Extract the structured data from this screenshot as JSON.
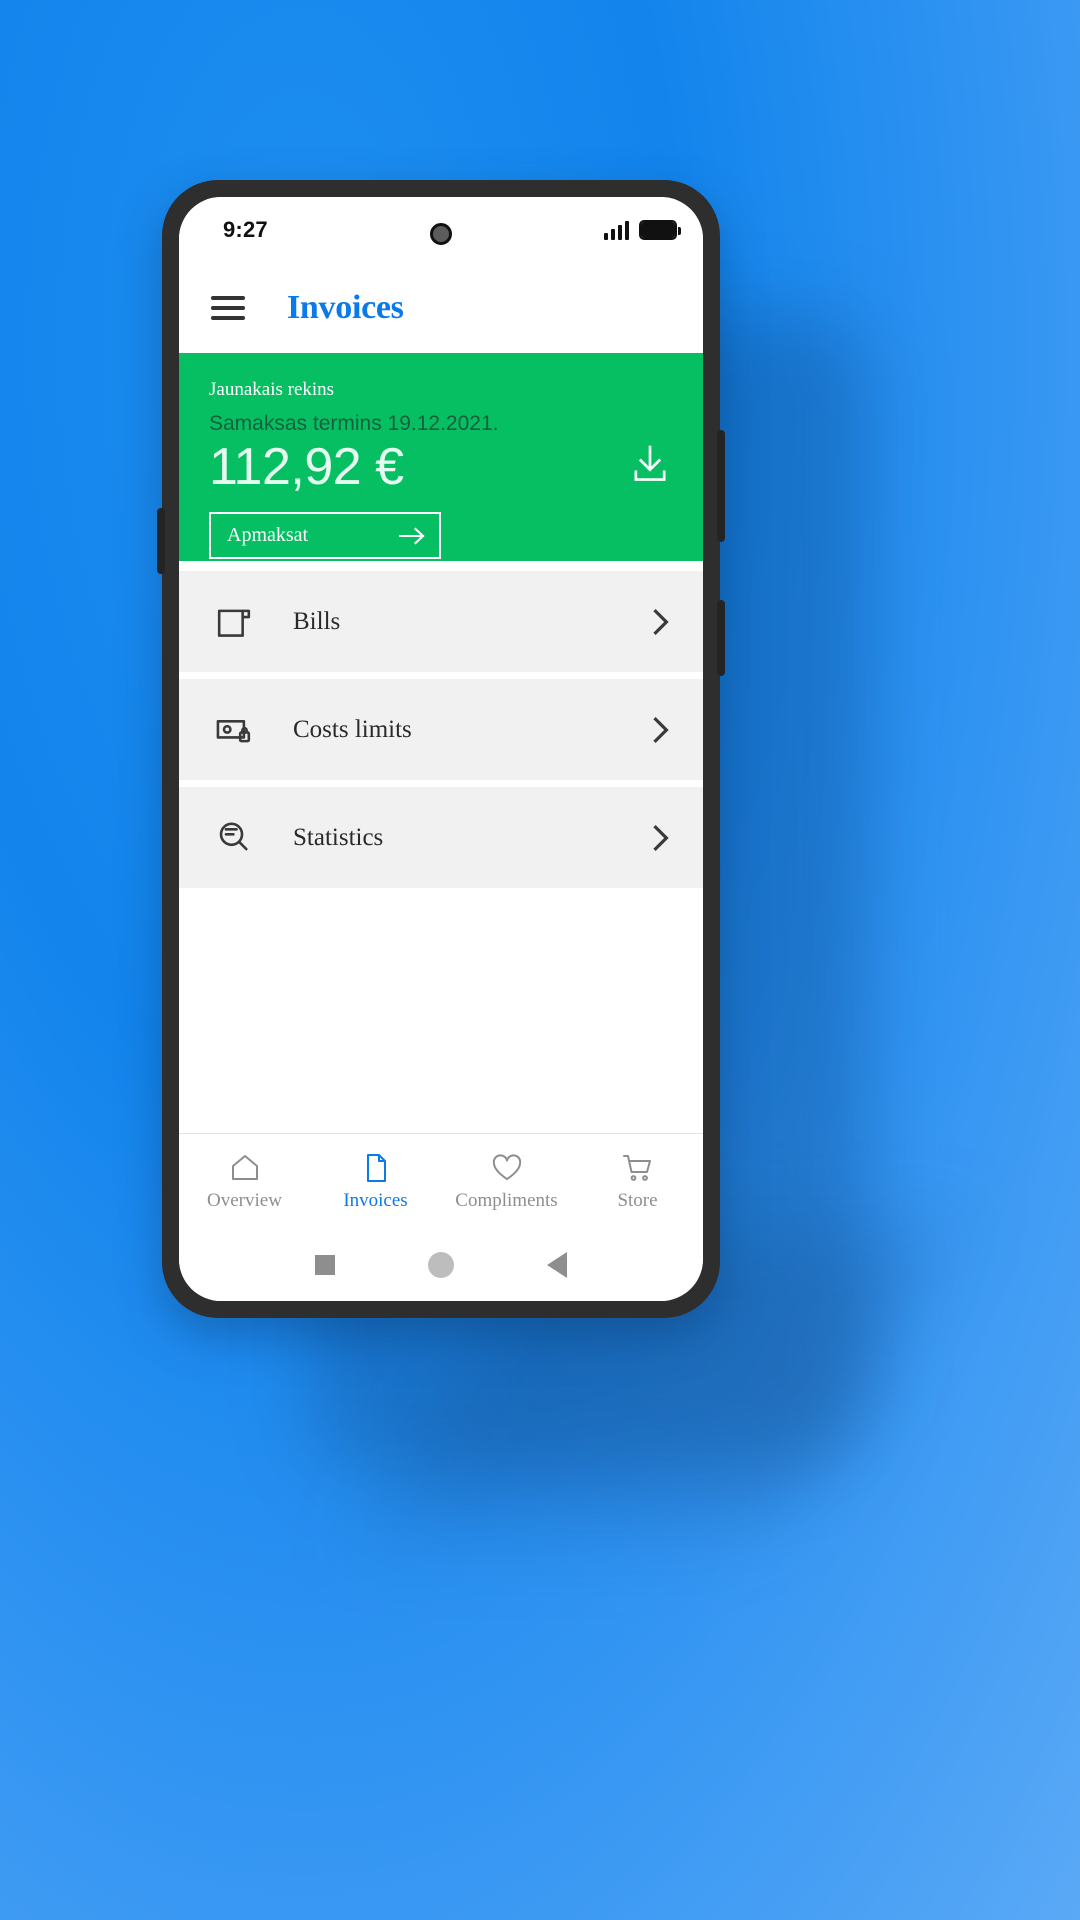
{
  "status_bar": {
    "time": "9:27",
    "signal_icon": "signal-bars-icon",
    "battery_icon": "battery-full-icon",
    "camera_icon": "front-camera-punch-hole"
  },
  "app_bar": {
    "menu_icon": "hamburger-menu-icon",
    "title": "Invoices"
  },
  "invoice_card": {
    "accent_color": "#06BF63",
    "subtitle": "Jaunakais rekins",
    "due_text": "Samaksas termins 19.12.2021.",
    "amount": "112,92 €",
    "download_icon": "download-icon",
    "pay_button": {
      "label": "Apmaksat",
      "arrow_icon": "arrow-right-icon"
    }
  },
  "menu": {
    "items": [
      {
        "label": "Bills",
        "icon": "receipt-scroll-icon",
        "chevron": "chevron-right-icon"
      },
      {
        "label": "Costs limits",
        "icon": "wallet-lock-icon",
        "chevron": "chevron-right-icon"
      },
      {
        "label": "Statistics",
        "icon": "magnifier-chart-icon",
        "chevron": "chevron-right-icon"
      }
    ]
  },
  "bottom_nav": {
    "active_color": "#0a7aea",
    "inactive_color": "#8e8e8e",
    "items": [
      {
        "label": "Overview",
        "icon": "home-icon",
        "active": false
      },
      {
        "label": "Invoices",
        "icon": "document-icon",
        "active": true
      },
      {
        "label": "Compliments",
        "icon": "heart-icon",
        "active": false
      },
      {
        "label": "Store",
        "icon": "shopping-cart-icon",
        "active": false
      }
    ]
  },
  "system_nav": {
    "recents_icon": "square-icon",
    "home_icon": "circle-icon",
    "back_icon": "triangle-back-icon"
  }
}
